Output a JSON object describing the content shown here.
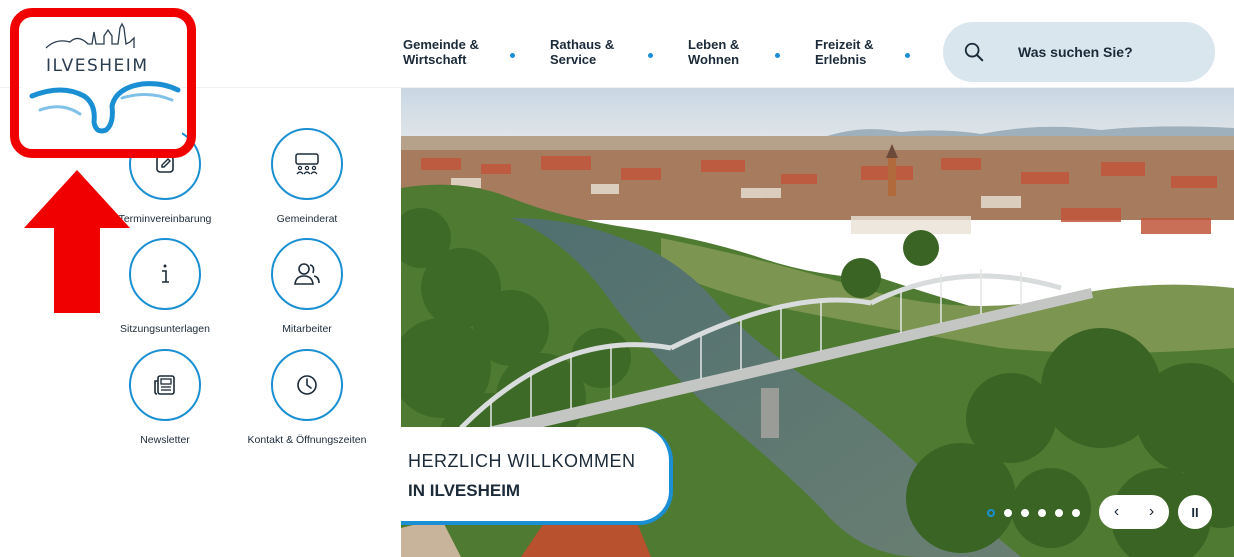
{
  "logo": {
    "text": "ILVESHEIM"
  },
  "nav": {
    "items": [
      {
        "line1": "Gemeinde &",
        "line2": "Wirtschaft"
      },
      {
        "line1": "Rathaus &",
        "line2": "Service"
      },
      {
        "line1": "Leben &",
        "line2": "Wohnen"
      },
      {
        "line1": "Freizeit &",
        "line2": "Erlebnis"
      }
    ]
  },
  "search": {
    "placeholder": "Was suchen Sie?",
    "icon": "search-icon"
  },
  "quick_links": [
    {
      "label": "Terminvereinbarung",
      "icon": "edit-icon"
    },
    {
      "label": "Gemeinderat",
      "icon": "council-icon"
    },
    {
      "label": "Sitzungsunterlagen",
      "icon": "info-icon"
    },
    {
      "label": "Mitarbeiter",
      "icon": "people-icon"
    },
    {
      "label": "Newsletter",
      "icon": "newspaper-icon"
    },
    {
      "label": "Kontakt & Öffnungszeiten",
      "icon": "clock-icon"
    }
  ],
  "hero": {
    "welcome_line1": "HERZLICH WILLKOMMEN",
    "welcome_line2": "IN ILVESHEIM",
    "slides_total": 6,
    "active_slide": 1,
    "prev_label": "‹",
    "next_label": "›",
    "pause_label": "II"
  },
  "colors": {
    "accent": "#1b8fd3",
    "search_bg": "#d9e6ee",
    "annotation": "#f10000"
  }
}
